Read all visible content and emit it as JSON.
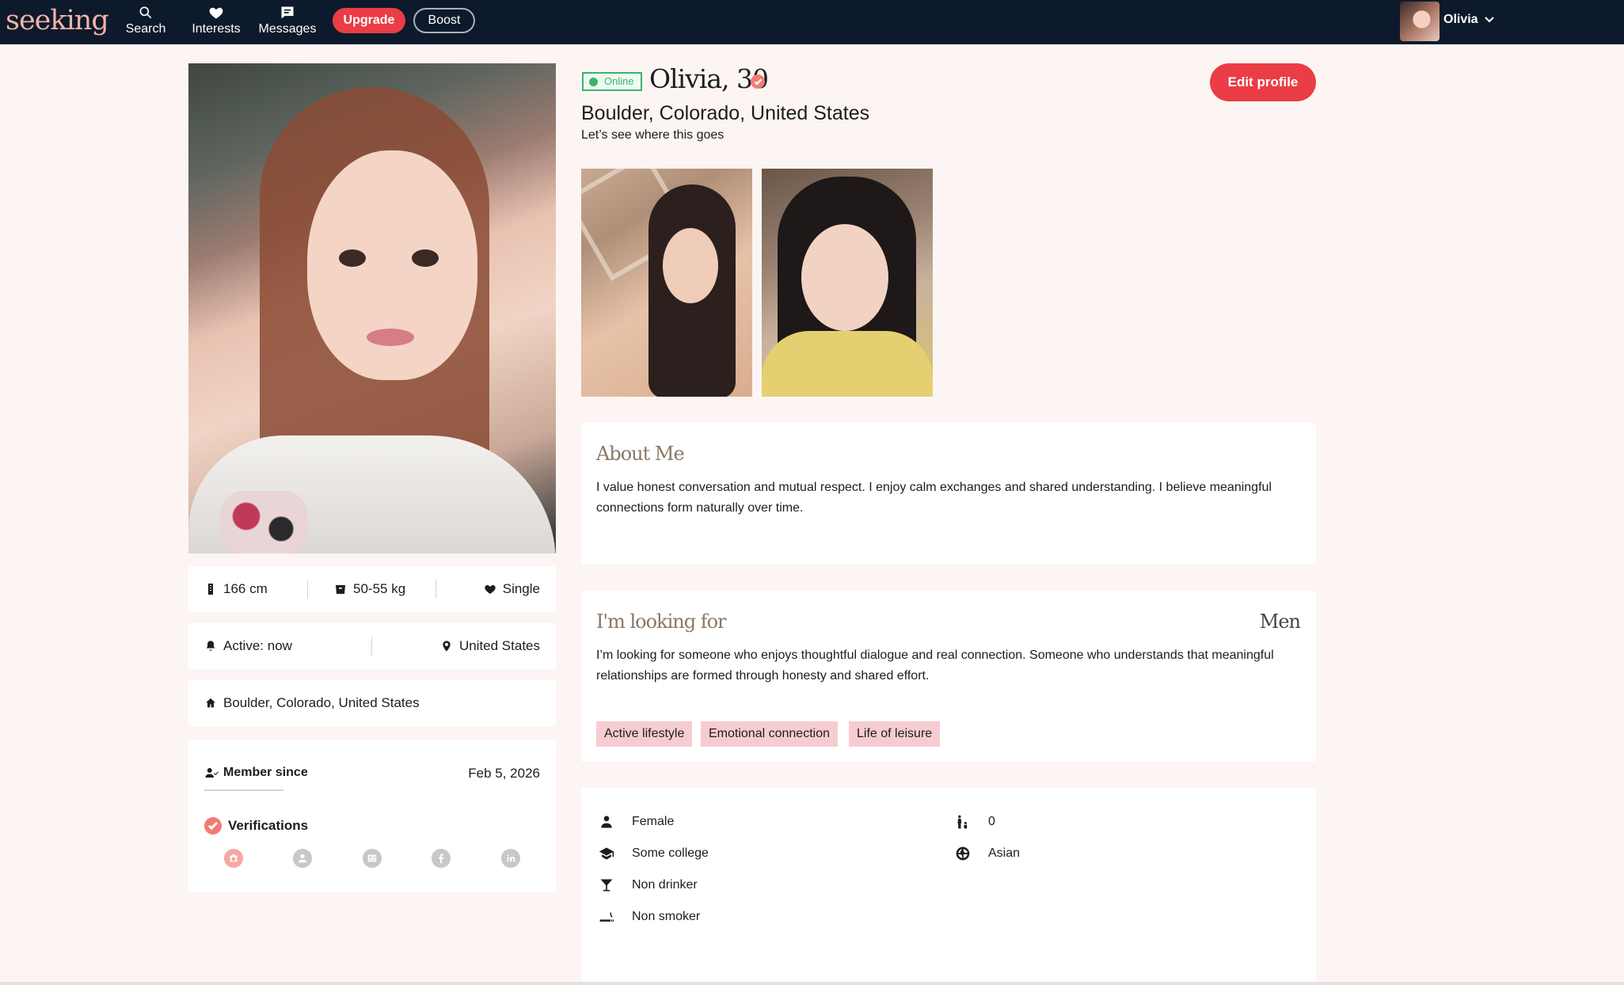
{
  "nav": {
    "logo": "seeking",
    "items": [
      {
        "label": "Search",
        "icon": "search-icon"
      },
      {
        "label": "Interests",
        "icon": "heart-icon"
      },
      {
        "label": "Messages",
        "icon": "message-icon"
      }
    ],
    "upgrade_label": "Upgrade",
    "boost_label": "Boost",
    "user": {
      "name": "Olivia",
      "icon": "chevron-down-icon"
    }
  },
  "profile": {
    "status": "Online",
    "name_age": "Olivia, 30",
    "location": "Boulder, Colorado, United States",
    "tagline": "Let’s see where this goes",
    "edit_label": "Edit profile"
  },
  "stats": {
    "height": "166 cm",
    "weight": "50-55 kg",
    "relationship": "Single",
    "active": "Active: now",
    "country": "United States",
    "home": "Boulder, Colorado, United States"
  },
  "member": {
    "label": "Member since",
    "date": "Feb 5, 2026",
    "verifications_label": "Verifications",
    "verification_icons": [
      "photo-verification-icon",
      "profile-verification-icon",
      "id-verification-icon",
      "facebook-icon",
      "linkedin-icon"
    ]
  },
  "about": {
    "title": "About Me",
    "text": "I value honest conversation and mutual respect. I enjoy calm exchanges and shared understanding. I believe meaningful connections form naturally over time."
  },
  "looking_for": {
    "title": "I'm looking for",
    "value": "Men",
    "text": "I’m looking for someone who enjoys thoughtful dialogue and real connection. Someone who understands that meaningful relationships are formed through honesty and shared effort.",
    "tags": [
      "Active lifestyle",
      "Emotional connection",
      "Life of leisure"
    ]
  },
  "details": {
    "gender": "Female",
    "education": "Some college",
    "drinking": "Non drinker",
    "smoking": "Non smoker",
    "children": "0",
    "ethnicity": "Asian"
  },
  "colors": {
    "nav_bg": "#0d1a2b",
    "accent": "#ea3d45",
    "page_bg": "#fcf5f3",
    "tag_bg": "#f7ccd0",
    "online": "#3bb36c"
  }
}
